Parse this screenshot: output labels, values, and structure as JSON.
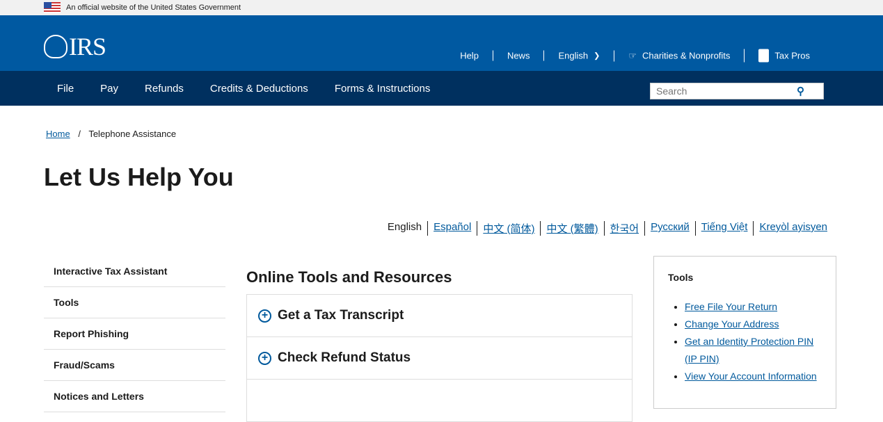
{
  "banner": "An official website of the United States Government",
  "logo": "IRS",
  "utility": {
    "help": "Help",
    "news": "News",
    "language": "English",
    "charities": "Charities & Nonprofits",
    "taxpros": "Tax Pros"
  },
  "nav": [
    "File",
    "Pay",
    "Refunds",
    "Credits & Deductions",
    "Forms & Instructions"
  ],
  "search": {
    "placeholder": "Search"
  },
  "breadcrumb": {
    "home": "Home",
    "sep": "/",
    "current": "Telephone Assistance"
  },
  "title": "Let Us Help You",
  "languages": [
    "English",
    "Español",
    "中文 (简体)",
    "中文 (繁體)",
    "한국어",
    "Русский",
    "Tiếng Việt",
    "Kreyòl ayisyen"
  ],
  "sidebar": [
    "Interactive Tax Assistant",
    "Tools",
    "Report Phishing",
    "Fraud/Scams",
    "Notices and Letters"
  ],
  "main": {
    "heading": "Online Tools and Resources",
    "items": [
      "Get a Tax Transcript",
      "Check Refund Status"
    ]
  },
  "tools": {
    "heading": "Tools",
    "links": [
      "Free File Your Return",
      "Change Your Address",
      "Get an Identity Protection PIN (IP PIN)",
      "View Your Account Information"
    ]
  }
}
